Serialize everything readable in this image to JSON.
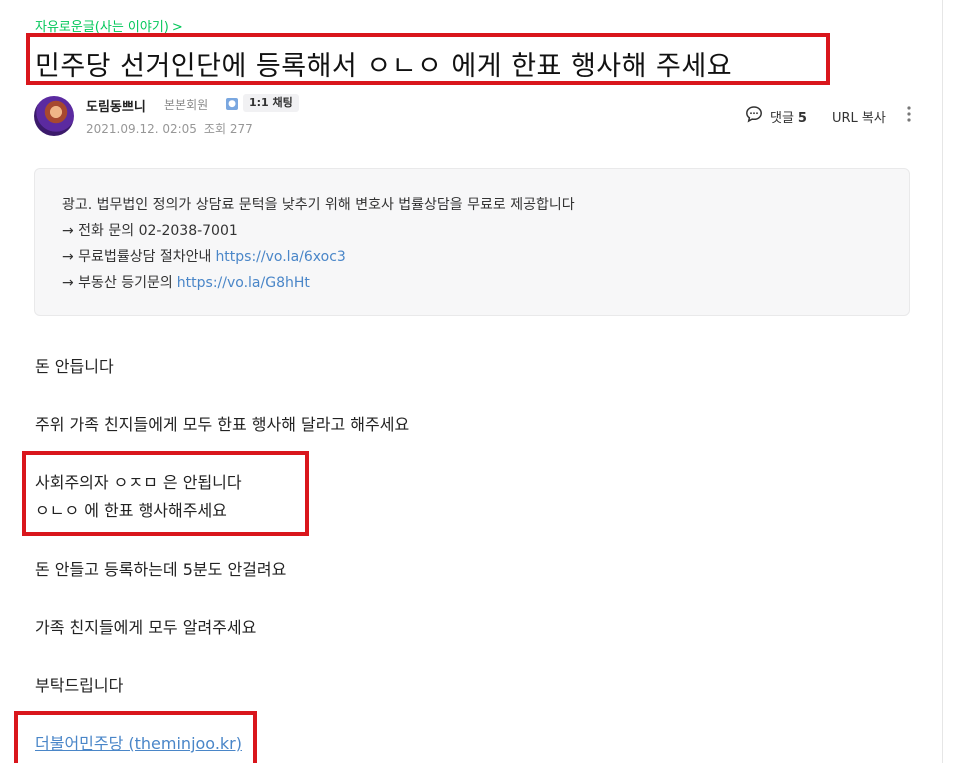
{
  "board": {
    "name": "자유로운글(사는 이야기)",
    "chevron": ">"
  },
  "post": {
    "title": "민주당 선거인단에 등록해서 ㅇㄴㅇ 에게 한표 행사해 주세요",
    "author": "도림동쁘니",
    "rank": "본본회원",
    "rank_badge_icon": "member-badge-icon",
    "chat_button": "1:1 채팅",
    "date": "2021.09.12. 02:05",
    "views": "조회 277",
    "comment_label": "댓글",
    "comment_count": "5",
    "url_copy": "URL 복사",
    "more_icon": "more-vertical-icon"
  },
  "ad": {
    "line1": "광고. 법무법인 정의가 상담료 문턱을 낮추기 위해 변호사 법률상담을 무료로 제공합니다",
    "line2": "→ 전화 문의 02-2038-7001",
    "line3_text": "→ 무료법률상담 절차안내",
    "line3_link": "https://vo.la/6xoc3",
    "line4_text": "→ 부동산 등기문의",
    "line4_link": "https://vo.la/G8hHt"
  },
  "body": {
    "p1": "돈 안듭니다",
    "p2": "주위 가족 친지들에게 모두 한표 행사해 달라고 해주세요",
    "p3a": "사회주의자 ㅇㅈㅁ 은 안됩니다",
    "p3b": "ㅇㄴㅇ 에  한표 행사해주세요",
    "p4": "돈 안들고 등록하는데  5분도 안걸려요",
    "p5": "가족 친지들에게 모두 알려주세요",
    "p6": "부탁드립니다",
    "link": "더불어민주당 (theminjoo.kr)"
  },
  "colors": {
    "accent_green": "#03c75a",
    "highlight_red": "#d9161c",
    "link_blue": "#4a86c8"
  }
}
